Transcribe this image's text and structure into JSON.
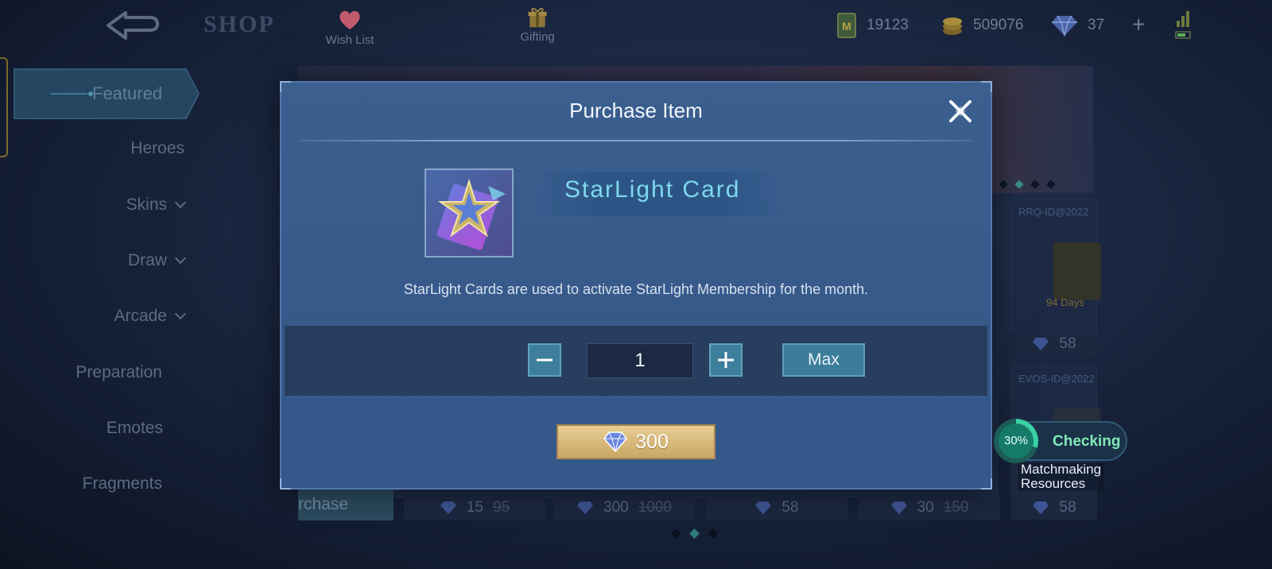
{
  "topbar": {
    "title": "SHOP",
    "tabs": [
      {
        "label": "Wish List",
        "icon": "heart-icon"
      },
      {
        "label": "Gifting",
        "icon": "gift-icon"
      }
    ],
    "currencies": [
      {
        "value": "19123",
        "icon": "ticket-icon"
      },
      {
        "value": "509076",
        "icon": "gold-coin-icon"
      },
      {
        "value": "37",
        "icon": "diamond-icon"
      }
    ],
    "add_label": "+"
  },
  "sidebar": {
    "items": [
      {
        "label": "Featured",
        "active": true,
        "expandable": false
      },
      {
        "label": "Heroes",
        "active": false,
        "expandable": false
      },
      {
        "label": "Skins",
        "active": false,
        "expandable": true
      },
      {
        "label": "Draw",
        "active": false,
        "expandable": true
      },
      {
        "label": "Arcade",
        "active": false,
        "expandable": true
      },
      {
        "label": "Preparation",
        "active": false,
        "expandable": false
      },
      {
        "label": "Emotes",
        "active": false,
        "expandable": false
      },
      {
        "label": "Fragments",
        "active": false,
        "expandable": false
      }
    ]
  },
  "background": {
    "cards": [
      {
        "tag": "RRQ-ID@2022",
        "days": "94 Days",
        "price": "58"
      },
      {
        "tag": "EVOS-ID@2022",
        "price": "58"
      }
    ],
    "bottom_prices": [
      {
        "price": "15",
        "old": "95"
      },
      {
        "price": "300",
        "old": "1000"
      },
      {
        "price": "58",
        "old": ""
      },
      {
        "price": "30",
        "old": "150"
      },
      {
        "price": "58",
        "old": ""
      }
    ],
    "purchase_label": "rchase"
  },
  "modal": {
    "title": "Purchase Item",
    "item_name": "StarLight Card",
    "description": "StarLight Cards are used to activate StarLight Membership for the month.",
    "quantity": "1",
    "max_label": "Max",
    "price": "300",
    "currency_icon": "diamond-icon"
  },
  "matchmaking": {
    "progress_label": "30%",
    "progress": 0.3,
    "status": "Checking",
    "label_line1": "Matchmaking",
    "label_line2": "Resources"
  },
  "colors": {
    "modal_bg": "#3b5f8f",
    "accent_teal": "#3d7f9c",
    "gold_button": "#e8cd92",
    "status_green": "#7fe9b7",
    "item_name": "#7fd8ee"
  }
}
